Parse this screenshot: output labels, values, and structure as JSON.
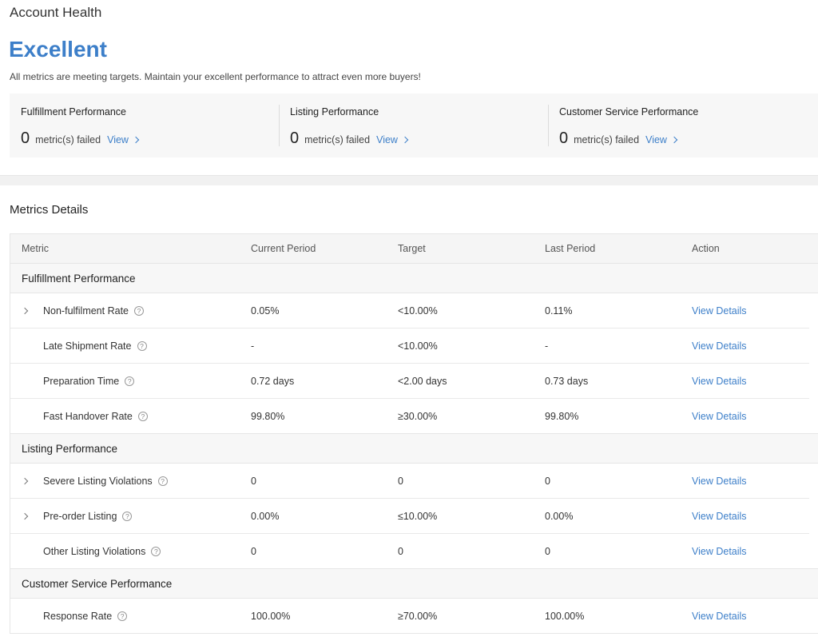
{
  "header": {
    "title": "Account Health",
    "status": "Excellent",
    "description": "All metrics are meeting targets. Maintain your excellent performance to attract even more buyers!",
    "status_color": "#3d7fc9"
  },
  "summary": [
    {
      "title": "Fulfillment Performance",
      "count": "0",
      "label": "metric(s) failed",
      "link": "View"
    },
    {
      "title": "Listing Performance",
      "count": "0",
      "label": "metric(s) failed",
      "link": "View"
    },
    {
      "title": "Customer Service Performance",
      "count": "0",
      "label": "metric(s) failed",
      "link": "View"
    }
  ],
  "details": {
    "title": "Metrics Details",
    "columns": [
      "Metric",
      "Current Period",
      "Target",
      "Last Period",
      "Action"
    ],
    "help_glyph": "?",
    "groups": [
      {
        "name": "Fulfillment Performance",
        "rows": [
          {
            "metric": "Non-fulfilment Rate",
            "current": "0.05%",
            "target": "<10.00%",
            "last": "0.11%",
            "action": "View Details",
            "expandable": true
          },
          {
            "metric": "Late Shipment Rate",
            "current": "-",
            "target": "<10.00%",
            "last": "-",
            "action": "View Details",
            "expandable": false
          },
          {
            "metric": "Preparation Time",
            "current": "0.72 days",
            "target": "<2.00 days",
            "last": "0.73 days",
            "action": "View Details",
            "expandable": false
          },
          {
            "metric": "Fast Handover Rate",
            "current": "99.80%",
            "target": "≥30.00%",
            "last": "99.80%",
            "action": "View Details",
            "expandable": false
          }
        ]
      },
      {
        "name": "Listing Performance",
        "rows": [
          {
            "metric": "Severe Listing Violations",
            "current": "0",
            "target": "0",
            "last": "0",
            "action": "View Details",
            "expandable": true
          },
          {
            "metric": "Pre-order Listing",
            "current": "0.00%",
            "target": "≤10.00%",
            "last": "0.00%",
            "action": "View Details",
            "expandable": true
          },
          {
            "metric": "Other Listing Violations",
            "current": "0",
            "target": "0",
            "last": "0",
            "action": "View Details",
            "expandable": false
          }
        ]
      },
      {
        "name": "Customer Service Performance",
        "rows": [
          {
            "metric": "Response Rate",
            "current": "100.00%",
            "target": "≥70.00%",
            "last": "100.00%",
            "action": "View Details",
            "expandable": false
          }
        ]
      }
    ]
  }
}
